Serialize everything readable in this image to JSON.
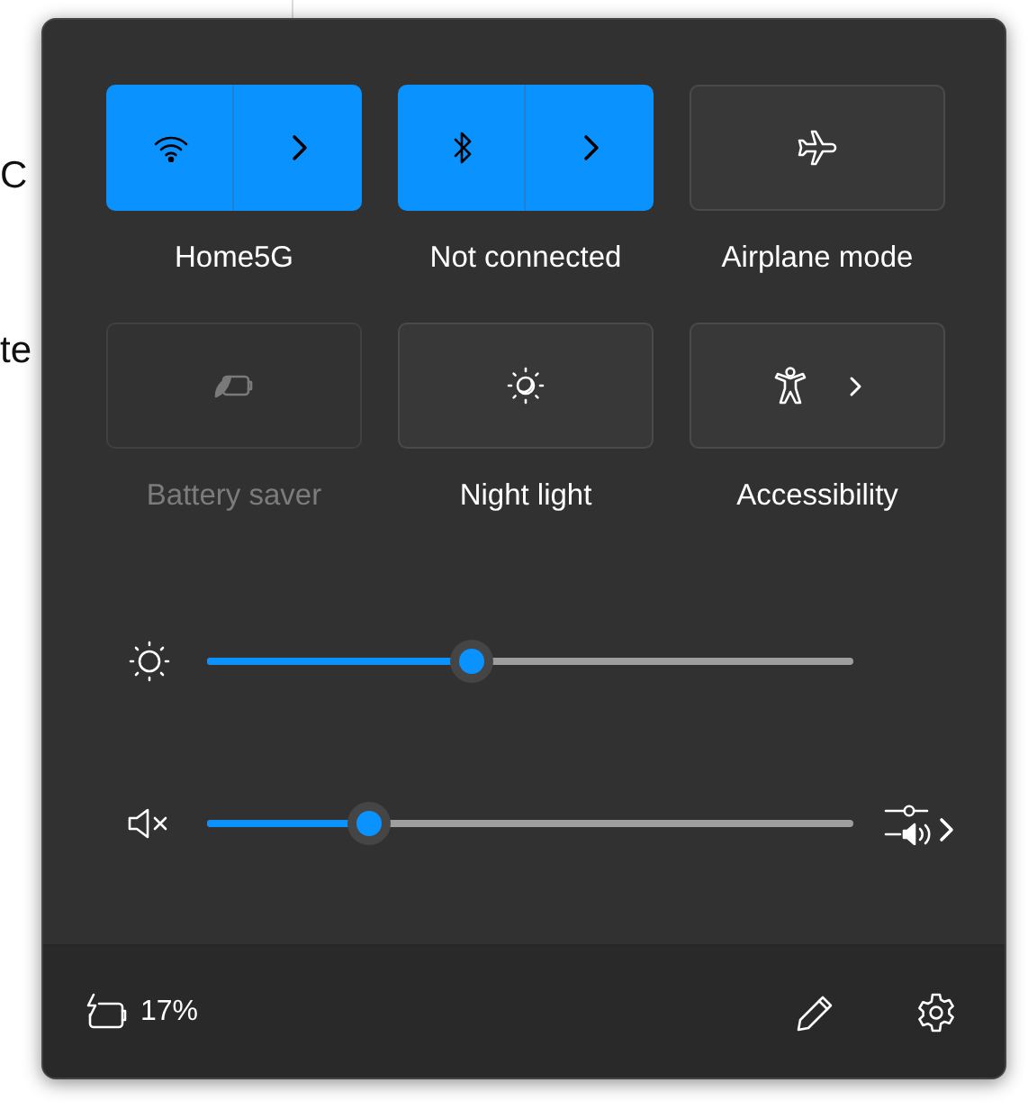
{
  "background_page": {
    "texts": [
      "C",
      "te"
    ]
  },
  "quick_settings": {
    "tiles": [
      {
        "kind": "split",
        "label": "Home5G",
        "on": true,
        "disabled": false
      },
      {
        "kind": "split",
        "label": "Not connected",
        "on": true,
        "disabled": false
      },
      {
        "kind": "plain",
        "label": "Airplane mode",
        "on": false,
        "disabled": false
      },
      {
        "kind": "plain",
        "label": "Battery saver",
        "on": false,
        "disabled": true
      },
      {
        "kind": "plain",
        "label": "Night light",
        "on": false,
        "disabled": false
      },
      {
        "kind": "chevron",
        "label": "Accessibility",
        "on": false,
        "disabled": false
      }
    ],
    "sliders": [
      {
        "kind": "brightness",
        "level": 0.41
      },
      {
        "kind": "volume",
        "level": 0.25
      }
    ],
    "footer": {
      "battery": "17%"
    }
  }
}
